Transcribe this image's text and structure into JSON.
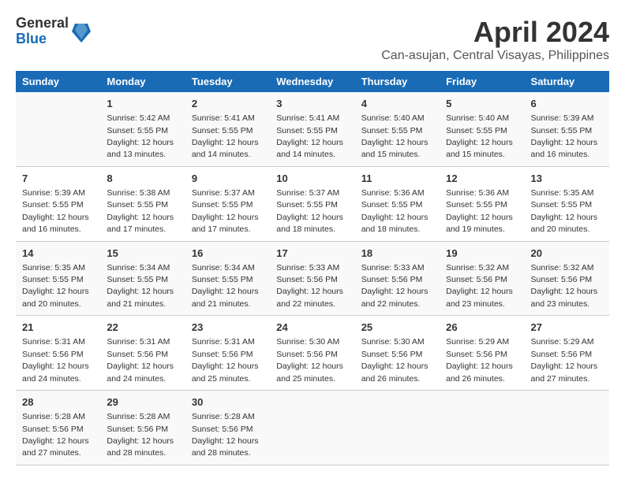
{
  "logo": {
    "general": "General",
    "blue": "Blue"
  },
  "title": "April 2024",
  "location": "Can-asujan, Central Visayas, Philippines",
  "header": {
    "days": [
      "Sunday",
      "Monday",
      "Tuesday",
      "Wednesday",
      "Thursday",
      "Friday",
      "Saturday"
    ]
  },
  "weeks": [
    [
      {
        "day": "",
        "sunrise": "",
        "sunset": "",
        "daylight": ""
      },
      {
        "day": "1",
        "sunrise": "Sunrise: 5:42 AM",
        "sunset": "Sunset: 5:55 PM",
        "daylight": "Daylight: 12 hours and 13 minutes."
      },
      {
        "day": "2",
        "sunrise": "Sunrise: 5:41 AM",
        "sunset": "Sunset: 5:55 PM",
        "daylight": "Daylight: 12 hours and 14 minutes."
      },
      {
        "day": "3",
        "sunrise": "Sunrise: 5:41 AM",
        "sunset": "Sunset: 5:55 PM",
        "daylight": "Daylight: 12 hours and 14 minutes."
      },
      {
        "day": "4",
        "sunrise": "Sunrise: 5:40 AM",
        "sunset": "Sunset: 5:55 PM",
        "daylight": "Daylight: 12 hours and 15 minutes."
      },
      {
        "day": "5",
        "sunrise": "Sunrise: 5:40 AM",
        "sunset": "Sunset: 5:55 PM",
        "daylight": "Daylight: 12 hours and 15 minutes."
      },
      {
        "day": "6",
        "sunrise": "Sunrise: 5:39 AM",
        "sunset": "Sunset: 5:55 PM",
        "daylight": "Daylight: 12 hours and 16 minutes."
      }
    ],
    [
      {
        "day": "7",
        "sunrise": "Sunrise: 5:39 AM",
        "sunset": "Sunset: 5:55 PM",
        "daylight": "Daylight: 12 hours and 16 minutes."
      },
      {
        "day": "8",
        "sunrise": "Sunrise: 5:38 AM",
        "sunset": "Sunset: 5:55 PM",
        "daylight": "Daylight: 12 hours and 17 minutes."
      },
      {
        "day": "9",
        "sunrise": "Sunrise: 5:37 AM",
        "sunset": "Sunset: 5:55 PM",
        "daylight": "Daylight: 12 hours and 17 minutes."
      },
      {
        "day": "10",
        "sunrise": "Sunrise: 5:37 AM",
        "sunset": "Sunset: 5:55 PM",
        "daylight": "Daylight: 12 hours and 18 minutes."
      },
      {
        "day": "11",
        "sunrise": "Sunrise: 5:36 AM",
        "sunset": "Sunset: 5:55 PM",
        "daylight": "Daylight: 12 hours and 18 minutes."
      },
      {
        "day": "12",
        "sunrise": "Sunrise: 5:36 AM",
        "sunset": "Sunset: 5:55 PM",
        "daylight": "Daylight: 12 hours and 19 minutes."
      },
      {
        "day": "13",
        "sunrise": "Sunrise: 5:35 AM",
        "sunset": "Sunset: 5:55 PM",
        "daylight": "Daylight: 12 hours and 20 minutes."
      }
    ],
    [
      {
        "day": "14",
        "sunrise": "Sunrise: 5:35 AM",
        "sunset": "Sunset: 5:55 PM",
        "daylight": "Daylight: 12 hours and 20 minutes."
      },
      {
        "day": "15",
        "sunrise": "Sunrise: 5:34 AM",
        "sunset": "Sunset: 5:55 PM",
        "daylight": "Daylight: 12 hours and 21 minutes."
      },
      {
        "day": "16",
        "sunrise": "Sunrise: 5:34 AM",
        "sunset": "Sunset: 5:55 PM",
        "daylight": "Daylight: 12 hours and 21 minutes."
      },
      {
        "day": "17",
        "sunrise": "Sunrise: 5:33 AM",
        "sunset": "Sunset: 5:56 PM",
        "daylight": "Daylight: 12 hours and 22 minutes."
      },
      {
        "day": "18",
        "sunrise": "Sunrise: 5:33 AM",
        "sunset": "Sunset: 5:56 PM",
        "daylight": "Daylight: 12 hours and 22 minutes."
      },
      {
        "day": "19",
        "sunrise": "Sunrise: 5:32 AM",
        "sunset": "Sunset: 5:56 PM",
        "daylight": "Daylight: 12 hours and 23 minutes."
      },
      {
        "day": "20",
        "sunrise": "Sunrise: 5:32 AM",
        "sunset": "Sunset: 5:56 PM",
        "daylight": "Daylight: 12 hours and 23 minutes."
      }
    ],
    [
      {
        "day": "21",
        "sunrise": "Sunrise: 5:31 AM",
        "sunset": "Sunset: 5:56 PM",
        "daylight": "Daylight: 12 hours and 24 minutes."
      },
      {
        "day": "22",
        "sunrise": "Sunrise: 5:31 AM",
        "sunset": "Sunset: 5:56 PM",
        "daylight": "Daylight: 12 hours and 24 minutes."
      },
      {
        "day": "23",
        "sunrise": "Sunrise: 5:31 AM",
        "sunset": "Sunset: 5:56 PM",
        "daylight": "Daylight: 12 hours and 25 minutes."
      },
      {
        "day": "24",
        "sunrise": "Sunrise: 5:30 AM",
        "sunset": "Sunset: 5:56 PM",
        "daylight": "Daylight: 12 hours and 25 minutes."
      },
      {
        "day": "25",
        "sunrise": "Sunrise: 5:30 AM",
        "sunset": "Sunset: 5:56 PM",
        "daylight": "Daylight: 12 hours and 26 minutes."
      },
      {
        "day": "26",
        "sunrise": "Sunrise: 5:29 AM",
        "sunset": "Sunset: 5:56 PM",
        "daylight": "Daylight: 12 hours and 26 minutes."
      },
      {
        "day": "27",
        "sunrise": "Sunrise: 5:29 AM",
        "sunset": "Sunset: 5:56 PM",
        "daylight": "Daylight: 12 hours and 27 minutes."
      }
    ],
    [
      {
        "day": "28",
        "sunrise": "Sunrise: 5:28 AM",
        "sunset": "Sunset: 5:56 PM",
        "daylight": "Daylight: 12 hours and 27 minutes."
      },
      {
        "day": "29",
        "sunrise": "Sunrise: 5:28 AM",
        "sunset": "Sunset: 5:56 PM",
        "daylight": "Daylight: 12 hours and 28 minutes."
      },
      {
        "day": "30",
        "sunrise": "Sunrise: 5:28 AM",
        "sunset": "Sunset: 5:56 PM",
        "daylight": "Daylight: 12 hours and 28 minutes."
      },
      {
        "day": "",
        "sunrise": "",
        "sunset": "",
        "daylight": ""
      },
      {
        "day": "",
        "sunrise": "",
        "sunset": "",
        "daylight": ""
      },
      {
        "day": "",
        "sunrise": "",
        "sunset": "",
        "daylight": ""
      },
      {
        "day": "",
        "sunrise": "",
        "sunset": "",
        "daylight": ""
      }
    ]
  ]
}
